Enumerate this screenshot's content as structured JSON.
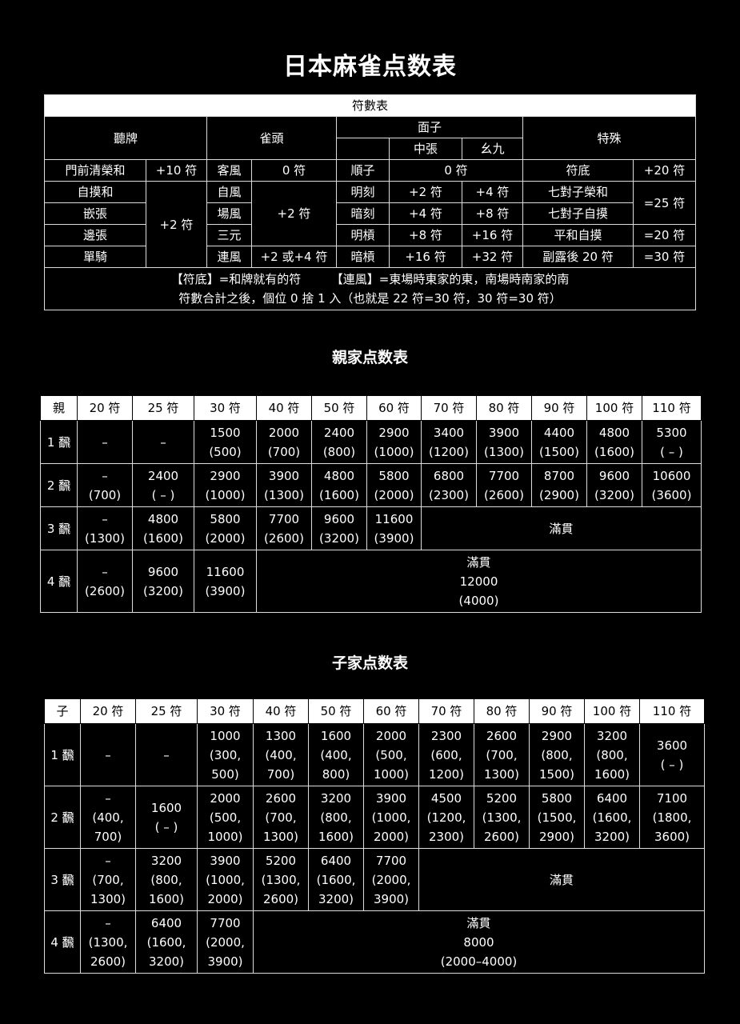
{
  "title": "日本麻雀点数表",
  "fu_table": {
    "caption": "符數表",
    "headers": {
      "tenpai": "聽牌",
      "jantou": "雀頭",
      "mentsu": "面子",
      "special": "特殊",
      "chunchan": "中張",
      "yaochu": "幺九"
    },
    "rows": [
      {
        "a": "門前清榮和",
        "a_val": "+10 符",
        "b": "客風",
        "b_val": "0 符",
        "c": "順子",
        "c_val": "0 符",
        "d": "符底",
        "d_val": "+20 符"
      },
      {
        "a": "自摸和",
        "b": "自風",
        "c": "明刻",
        "c_mid": "+2 符",
        "c_yao": "+4 符",
        "d": "七對子榮和",
        "d_val": "=25 符"
      },
      {
        "a": "嵌張",
        "b": "場風",
        "c": "暗刻",
        "c_mid": "+4 符",
        "c_yao": "+8 符",
        "d": "七對子自摸"
      },
      {
        "a": "邊張",
        "b": "三元",
        "c": "明槓",
        "c_mid": "+8 符",
        "c_yao": "+16 符",
        "d": "平和自摸",
        "d_val": "=20 符"
      },
      {
        "a": "單騎",
        "b": "連風",
        "b_val": "+2 或+4 符",
        "c": "暗槓",
        "c_mid": "+16 符",
        "c_yao": "+32 符",
        "d": "副露後 20 符",
        "d_val": "=30 符"
      }
    ],
    "group_a_val": "+2 符",
    "group_b_val": "+2 符",
    "note_line1": "【符底】=和牌就有的符　　　【連風】=東場時東家的東，南場時南家的南",
    "note_line2": "符數合計之後，個位 0 捨 1 入（也就是 22 符=30 符，30 符=30 符）"
  },
  "parent": {
    "title": "親家点数表",
    "header": [
      "親",
      "20 符",
      "25 符",
      "30 符",
      "40 符",
      "50 符",
      "60 符",
      "70 符",
      "80 符",
      "90 符",
      "100 符",
      "110 符"
    ],
    "rows": [
      {
        "han": "1 飜",
        "cells": [
          "–",
          "–",
          "1500\n(500)",
          "2000\n(700)",
          "2400\n(800)",
          "2900\n(1000)",
          "3400\n(1200)",
          "3900\n(1300)",
          "4400\n(1500)",
          "4800\n(1600)",
          "5300\n( – )"
        ]
      },
      {
        "han": "2 飜",
        "cells": [
          "–\n(700)",
          "2400\n( – )",
          "2900\n(1000)",
          "3900\n(1300)",
          "4800\n(1600)",
          "5800\n(2000)",
          "6800\n(2300)",
          "7700\n(2600)",
          "8700\n(2900)",
          "9600\n(3200)",
          "10600\n(3600)"
        ]
      },
      {
        "han": "3 飜",
        "cells": [
          "–\n(1300)",
          "4800\n(1600)",
          "5800\n(2000)",
          "7700\n(2600)",
          "9600\n(3200)",
          "11600\n(3900)"
        ],
        "mangan": "滿貫"
      },
      {
        "han": "4 飜",
        "cells": [
          "–\n(2600)",
          "9600\n(3200)",
          "11600\n(3900)"
        ],
        "mangan": "滿貫\n12000\n(4000)"
      }
    ]
  },
  "child": {
    "title": "子家点数表",
    "header": [
      "子",
      "20 符",
      "25 符",
      "30 符",
      "40 符",
      "50 符",
      "60 符",
      "70 符",
      "80 符",
      "90 符",
      "100 符",
      "110 符"
    ],
    "rows": [
      {
        "han": "1 飜",
        "cells": [
          "–",
          "–",
          "1000\n(300,\n500)",
          "1300\n(400,\n700)",
          "1600\n(400,\n800)",
          "2000\n(500,\n1000)",
          "2300\n(600,\n1200)",
          "2600\n(700,\n1300)",
          "2900\n(800,\n1500)",
          "3200\n(800,\n1600)",
          "3600\n( – )"
        ]
      },
      {
        "han": "2 飜",
        "cells": [
          "–\n(400,\n700)",
          "1600\n( – )",
          "2000\n(500,\n1000)",
          "2600\n(700,\n1300)",
          "3200\n(800,\n1600)",
          "3900\n(1000,\n2000)",
          "4500\n(1200,\n2300)",
          "5200\n(1300,\n2600)",
          "5800\n(1500,\n2900)",
          "6400\n(1600,\n3200)",
          "7100\n(1800,\n3600)"
        ]
      },
      {
        "han": "3 飜",
        "cells": [
          "–\n(700,\n1300)",
          "3200\n(800,\n1600)",
          "3900\n(1000,\n2000)",
          "5200\n(1300,\n2600)",
          "6400\n(1600,\n3200)",
          "7700\n(2000,\n3900)"
        ],
        "mangan": "滿貫"
      },
      {
        "han": "4 飜",
        "cells": [
          "–\n(1300,\n2600)",
          "6400\n(1600,\n3200)",
          "7700\n(2000,\n3900)"
        ],
        "mangan": "滿貫\n8000\n(2000–4000)"
      }
    ]
  }
}
